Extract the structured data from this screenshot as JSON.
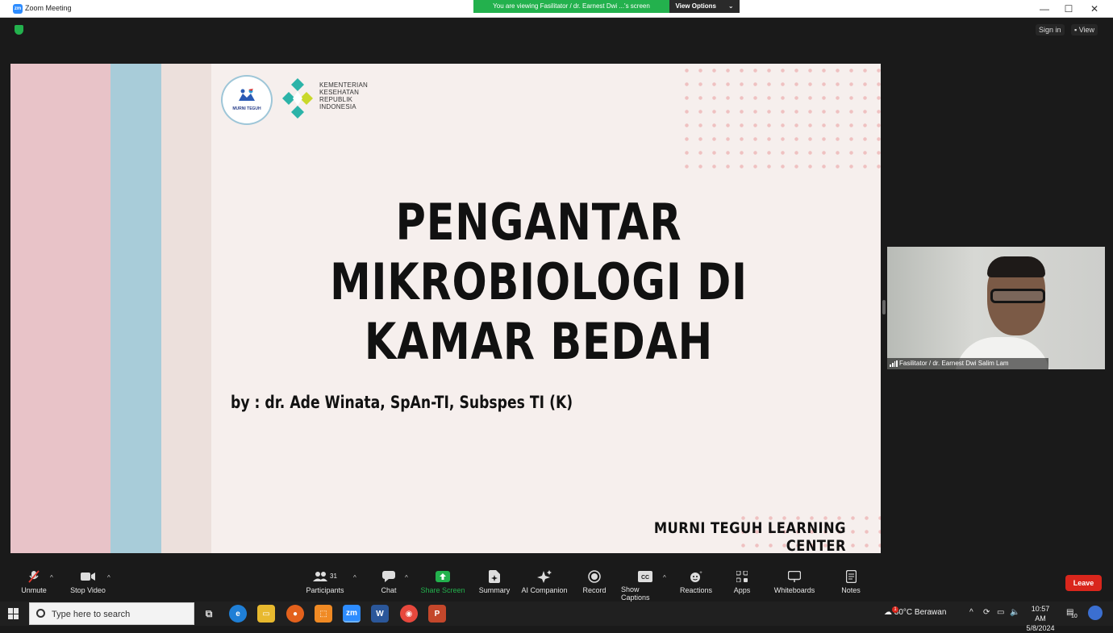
{
  "window": {
    "title": "Zoom Meeting",
    "minimize": "—",
    "maximize": "☐",
    "close": "✕"
  },
  "banner": {
    "viewing_text": "You are viewing Fasilitator / dr. Earnest Dwi ...'s screen",
    "view_options": "View Options",
    "view_options_caret": "⌄"
  },
  "topbar": {
    "sign_in": "Sign in",
    "view": "View"
  },
  "slide": {
    "logo_mt_text": "MURNI TEGUH",
    "kemenkes_lines": "KEMENTERIAN KESEHATAN REPUBLIK INDONESIA",
    "title_line1": "PENGANTAR",
    "title_line2": "MIKROBIOLOGI DI",
    "title_line3": "KAMAR BEDAH",
    "byline": "by : dr. Ade Winata, SpAn-TI, Subspes TI (K)",
    "footer": "MURNI TEGUH LEARNING CENTER",
    "colors": {
      "pink": "#e8c3c8",
      "blue": "#a8ccd9",
      "beige": "#ece0dc",
      "background": "#f6efed"
    }
  },
  "video": {
    "participant_name": "Fasilitator / dr. Earnest Dwi  Salim Lam"
  },
  "toolbar": {
    "unmute": "Unmute",
    "stop_video": "Stop Video",
    "participants": "Participants",
    "participants_count": "31",
    "chat": "Chat",
    "share_screen": "Share Screen",
    "summary": "Summary",
    "ai_companion": "AI Companion",
    "record": "Record",
    "show_captions": "Show Captions",
    "reactions": "Reactions",
    "apps": "Apps",
    "whiteboards": "Whiteboards",
    "notes": "Notes",
    "leave": "Leave",
    "share_color": "#23b14d",
    "leave_color": "#d9261c"
  },
  "taskbar": {
    "search_placeholder": "Type here to search",
    "temperature": "30°C",
    "weather": "Berawan",
    "time": "10:57 AM",
    "date": "5/8/2024",
    "notification_count": "10",
    "weather_badge": "1"
  }
}
